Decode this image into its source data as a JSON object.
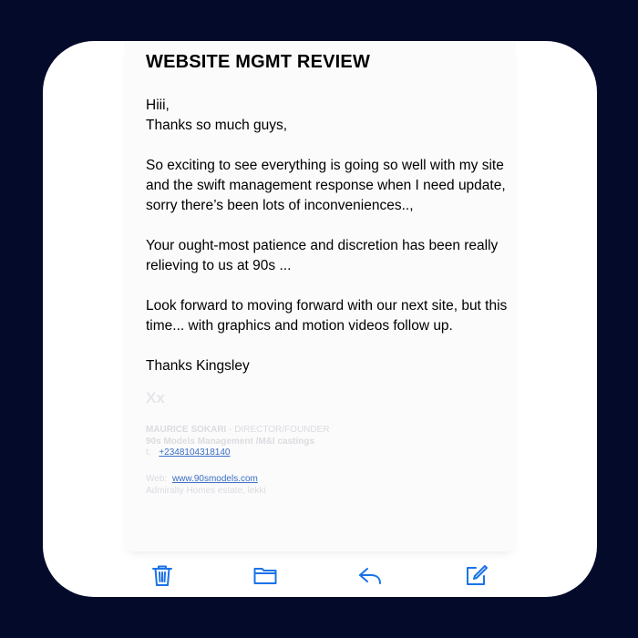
{
  "email": {
    "subject": "WEBSITE MGMT REVIEW",
    "greeting": "Hiii,",
    "line_thanks": "Thanks so much guys,",
    "paragraph_1": "So exciting to see everything is going so well with my site and the swift management response when I need update, sorry there’s been lots of inconveniences..,",
    "paragraph_2": "Your ought-most patience and discretion has been really relieving to us at 90s ...",
    "paragraph_3": "Look forward to moving forward with our next site, but this time... with graphics and motion videos follow up.",
    "closing": "Thanks Kingsley",
    "signoff": "Xx"
  },
  "signature": {
    "name": "MAURICE SOKARI",
    "title": "DIRECTOR/FOUNDER",
    "company": "90s Models Management /M&I castings",
    "phone_prefix": "t:",
    "phone": "+2348104318140",
    "web_prefix": "Web:",
    "website": "www.90smodels.com",
    "address": "Admiralty Homes estate, lekki"
  },
  "toolbar": {
    "accent_color": "#1a73e8",
    "icons": [
      "trash-icon",
      "folder-icon",
      "reply-icon",
      "compose-icon"
    ]
  }
}
